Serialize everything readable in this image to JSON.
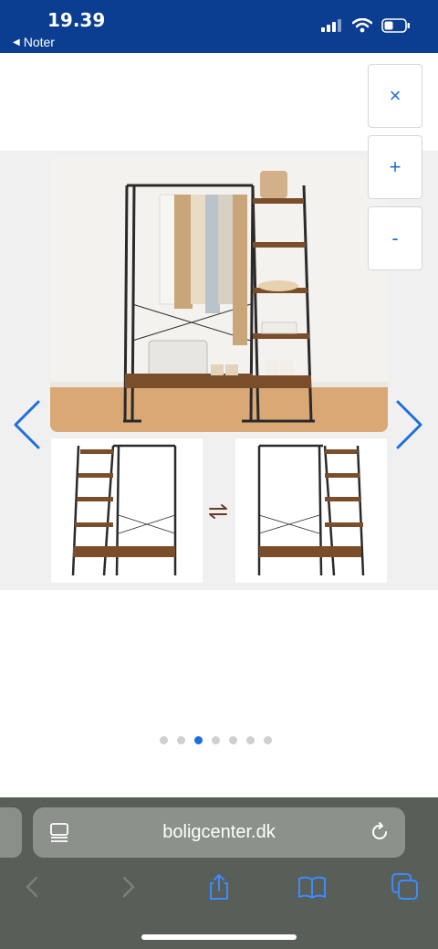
{
  "status_bar": {
    "time": "19.39",
    "back_label": "Noter"
  },
  "gallery": {
    "controls": {
      "close_label": "×",
      "zoom_in_label": "+",
      "zoom_out_label": "-"
    },
    "page_count": 7,
    "active_index": 2
  },
  "browser": {
    "url": "boligcenter.dk"
  },
  "colors": {
    "status_bar_bg": "#0b3d91",
    "accent": "#1e6fd9",
    "wood": "#7a4e2a",
    "frame": "#2a2a2a",
    "browser_bg": "#585e58"
  },
  "icons": {
    "close": "close-icon",
    "zoom_in": "plus-icon",
    "zoom_out": "minus-icon",
    "prev": "chevron-left-icon",
    "next": "chevron-right-icon",
    "swap": "swap-arrows-icon",
    "reader": "reader-icon",
    "reload": "reload-icon",
    "share": "share-icon",
    "bookmarks": "book-icon",
    "tabs": "tabs-icon"
  }
}
